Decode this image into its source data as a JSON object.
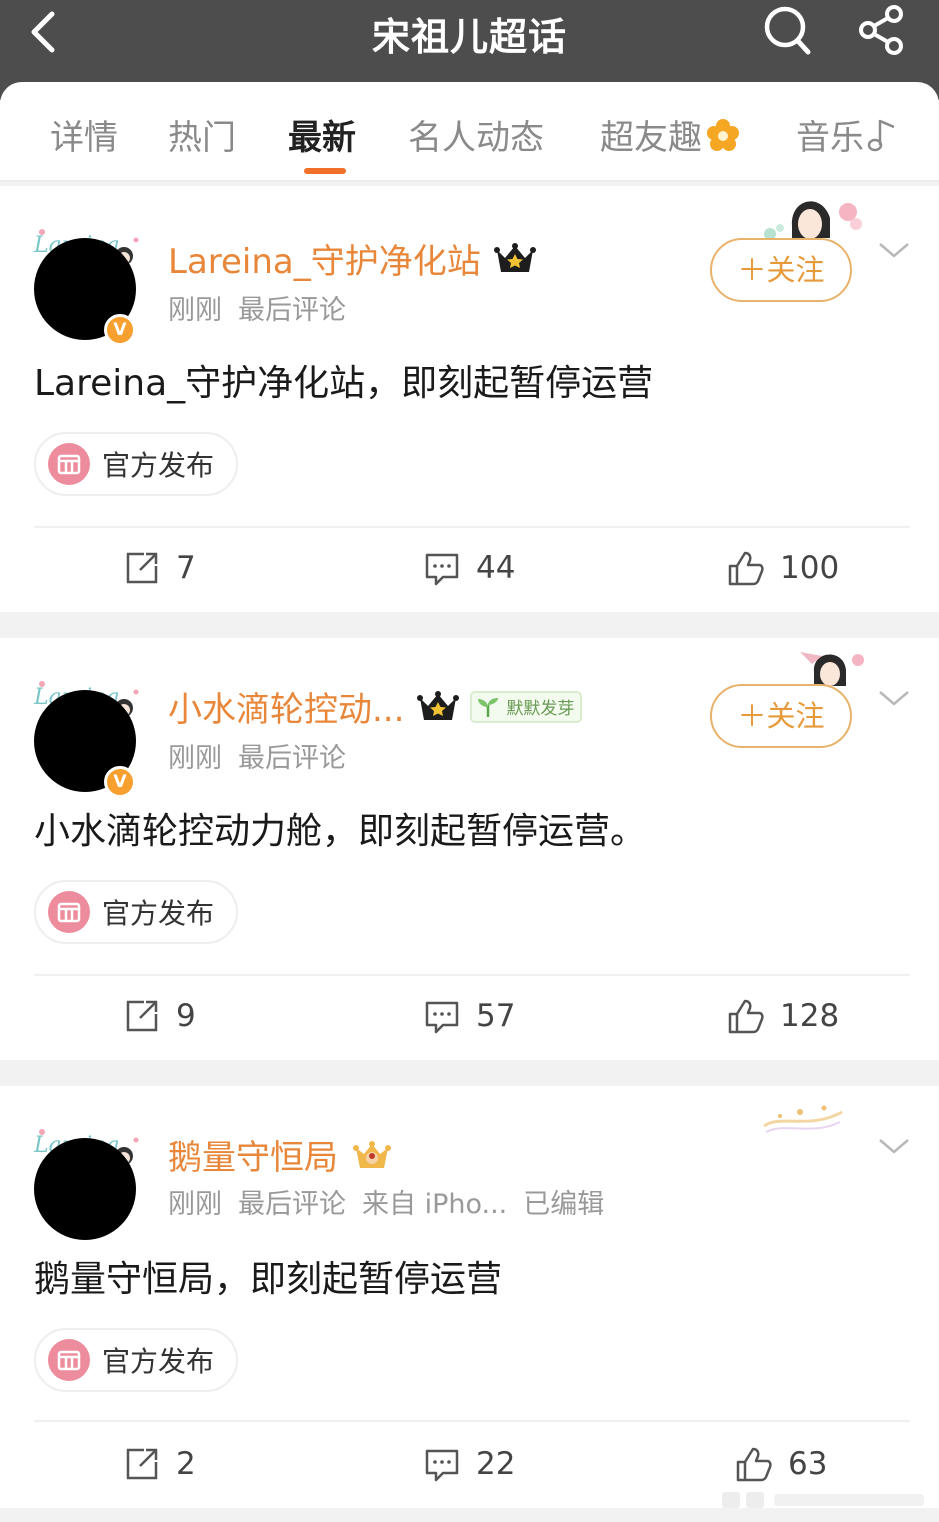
{
  "header": {
    "title": "宋祖儿超话",
    "back_icon": "back-arrow-icon",
    "search_icon": "search-icon",
    "share_icon": "share-icon"
  },
  "tabs": [
    {
      "label": "详情"
    },
    {
      "label": "热门"
    },
    {
      "label": "最新",
      "active": true
    },
    {
      "label": "名人动态"
    },
    {
      "label": "超友趣"
    },
    {
      "label": "音乐"
    }
  ],
  "posts": [
    {
      "username": "Lareina_守护净化站",
      "meta": [
        "刚刚",
        "最后评论"
      ],
      "text": "Lareina_守护净化站，即刻起暂停运营",
      "tag": "官方发布",
      "follow": "＋关注",
      "repost": "7",
      "comment": "44",
      "like": "100"
    },
    {
      "username": "小水滴轮控动...",
      "badge": "默默发芽",
      "meta": [
        "刚刚",
        "最后评论"
      ],
      "text": "小水滴轮控动力舱，即刻起暂停运营。",
      "tag": "官方发布",
      "follow": "＋关注",
      "repost": "9",
      "comment": "57",
      "like": "128"
    },
    {
      "username": "鹅量守恒局",
      "meta": [
        "刚刚",
        "最后评论",
        "来自 iPho...",
        "已编辑"
      ],
      "text": "鹅量守恒局，即刻起暂停运营",
      "tag": "官方发布",
      "repost": "2",
      "comment": "22",
      "like": "63"
    }
  ],
  "colors": {
    "header_bg": "#4d4d4d",
    "accent": "#f0702a",
    "username": "#e8873a",
    "follow_border": "#e8b26b"
  }
}
